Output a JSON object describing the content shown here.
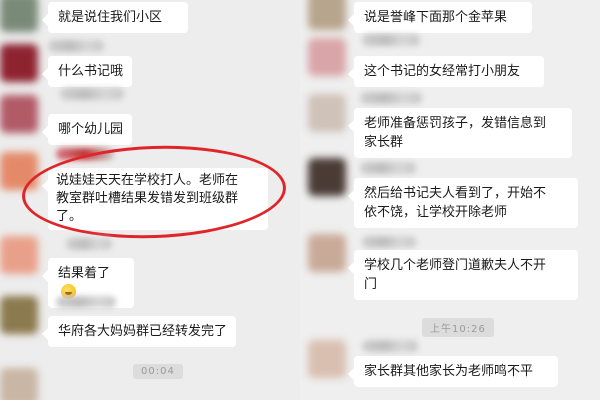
{
  "colors": {
    "highlight": "#e0252a",
    "bubble": "#ffffff",
    "background": "#ededed"
  },
  "left_messages": [
    {
      "lines": [
        "就是说住我们小区"
      ]
    },
    {
      "lines": [
        "什么书记哦"
      ]
    },
    {
      "lines": [
        "哪个幼儿园"
      ]
    },
    {
      "lines": [
        "说娃娃天天在学校打人。老师在",
        "教室群吐槽结果发错发到班级群",
        "了。"
      ]
    },
    {
      "lines": [
        "结果着了"
      ],
      "emoji": "emoji-icon"
    },
    {
      "lines": [
        "华府各大妈妈群已经转发完了"
      ]
    }
  ],
  "right_messages": [
    {
      "lines": [
        "说是誉峰下面那个金苹果"
      ]
    },
    {
      "lines": [
        "这个书记的女经常打小朋友"
      ]
    },
    {
      "lines": [
        "老师准备惩罚孩子，发错信息到",
        "家长群"
      ]
    },
    {
      "lines": [
        "然后给书记夫人看到了，开始不",
        "依不饶，让学校开除老师"
      ]
    },
    {
      "lines": [
        "学校几个老师登门道歉夫人不开",
        "门"
      ]
    },
    {
      "lines": [
        "家长群其他家长为老师鸣不平"
      ]
    }
  ],
  "timestamps": {
    "left_time": "00:04",
    "right_time": "上午10:26"
  }
}
